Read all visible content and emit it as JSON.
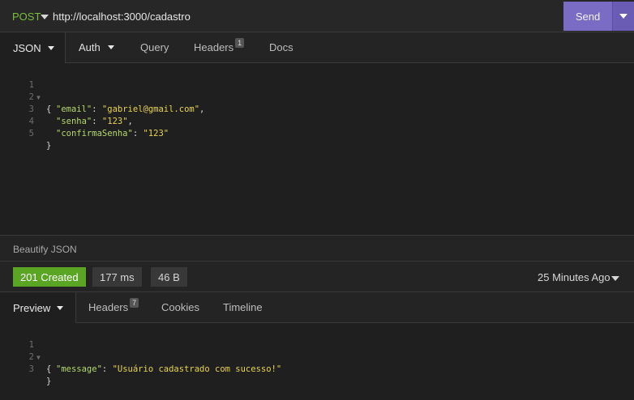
{
  "request": {
    "method": "POST",
    "url": "http://localhost:3000/cadastro",
    "send_label": "Send"
  },
  "request_tabs": [
    {
      "label": "JSON",
      "active": true,
      "has_caret": true
    },
    {
      "label": "Auth",
      "has_caret": true
    },
    {
      "label": "Query"
    },
    {
      "label": "Headers",
      "badge": "1"
    },
    {
      "label": "Docs"
    }
  ],
  "request_body": {
    "line_numbers": [
      "1",
      "2",
      "3",
      "4",
      "5"
    ],
    "lines": [
      {
        "open": "{"
      },
      {
        "key": "\"email\"",
        "value": "\"gabriel@gmail.com\"",
        "trail": ","
      },
      {
        "key": "\"senha\"",
        "value": "\"123\"",
        "trail": ","
      },
      {
        "key": "\"confirmaSenha\"",
        "value": "\"123\"",
        "trail": ""
      },
      {
        "close": "}"
      }
    ]
  },
  "beautify_label": "Beautify JSON",
  "response": {
    "status": "201 Created",
    "time": "177 ms",
    "size": "46 B",
    "time_ago": "25 Minutes Ago",
    "status_color": "#5aa524"
  },
  "response_tabs": [
    {
      "label": "Preview",
      "active": true,
      "has_caret": true
    },
    {
      "label": "Headers",
      "badge": "7"
    },
    {
      "label": "Cookies"
    },
    {
      "label": "Timeline"
    }
  ],
  "response_body": {
    "line_numbers": [
      "1",
      "2",
      "3"
    ],
    "lines": [
      {
        "open": "{"
      },
      {
        "key": "\"message\"",
        "value": "\"Usuário cadastrado com sucesso!\"",
        "trail": ""
      },
      {
        "close": "}"
      }
    ]
  },
  "colors": {
    "accent": "#7a6bc4",
    "method": "#7bbf3b",
    "string": "#e8d44d",
    "key": "#b5d96a"
  }
}
